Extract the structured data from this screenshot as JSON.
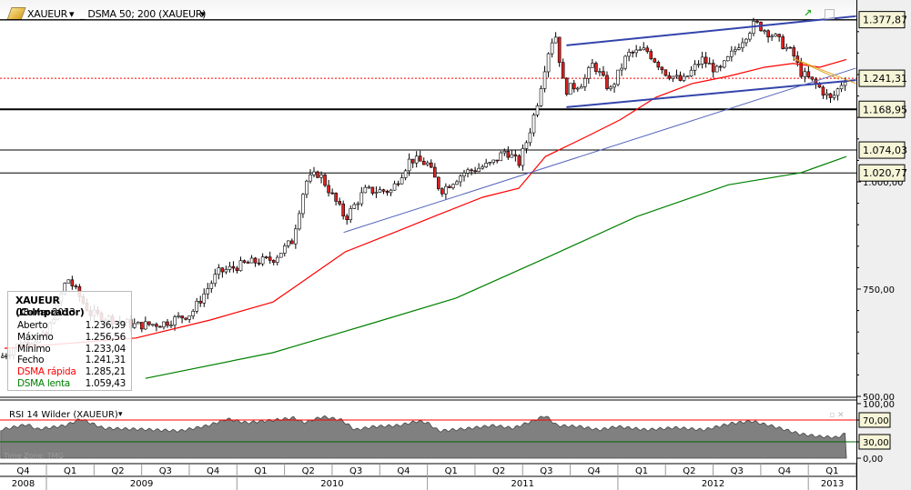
{
  "header": {
    "symbol": "XAUEUR",
    "indicator": "_ DSMA 50; 200 (XAUEUR)"
  },
  "info": {
    "title": "XAUEUR (Comprador)",
    "date": "18-Mar-2013",
    "rows": [
      {
        "label": "Aberto",
        "value": "1.236,39",
        "color": "#000000"
      },
      {
        "label": "Máximo",
        "value": "1.256,56",
        "color": "#000000"
      },
      {
        "label": "Mínimo",
        "value": "1.233,04",
        "color": "#000000"
      },
      {
        "label": "Fecho",
        "value": "1.241,31",
        "color": "#000000"
      },
      {
        "label": "DSMA rápida",
        "value": "1.285,21",
        "color": "#ff0000"
      },
      {
        "label": "DSMA lenta",
        "value": "1.059,43",
        "color": "#008000"
      }
    ]
  },
  "rsi": {
    "label": "RSI 14 Wilder (XAUEUR)",
    "time_zone": "Time Zone: TMG",
    "levels": [
      70,
      30
    ],
    "ticks": [
      "100,00",
      "70,00",
      "30,00",
      "0,00"
    ]
  },
  "chart_data": {
    "type": "candlestick",
    "title": "XAUEUR",
    "ylim": [
      500,
      1390
    ],
    "y_ticks": [
      "1.000,00",
      "750,00",
      "500,00"
    ],
    "price_labels": [
      "1.377,87",
      "1.241,31",
      "1.168,95",
      "1.074,03",
      "1.020,77"
    ],
    "horizontal_lines": [
      1377.87,
      1168.95,
      1074.03,
      1020.77
    ],
    "last_price": 1241.31,
    "x_quarters": [
      "Q4",
      "Q1",
      "Q2",
      "Q3",
      "Q4",
      "Q1",
      "Q2",
      "Q3",
      "Q4",
      "Q1",
      "Q2",
      "Q3",
      "Q4",
      "Q1",
      "Q2",
      "Q3",
      "Q4",
      "Q1"
    ],
    "x_years": [
      "2008",
      "2009",
      "2010",
      "2011",
      "2012",
      "2013"
    ],
    "price_path": [
      [
        2008.78,
        597
      ],
      [
        2008.85,
        620
      ],
      [
        2009.0,
        640
      ],
      [
        2009.11,
        777
      ],
      [
        2009.23,
        693
      ],
      [
        2009.47,
        665
      ],
      [
        2009.61,
        670
      ],
      [
        2009.76,
        693
      ],
      [
        2009.9,
        788
      ],
      [
        2010.05,
        810
      ],
      [
        2010.19,
        820
      ],
      [
        2010.29,
        862
      ],
      [
        2010.36,
        1000
      ],
      [
        2010.43,
        1021
      ],
      [
        2010.57,
        915
      ],
      [
        2010.67,
        979
      ],
      [
        2010.81,
        979
      ],
      [
        2010.91,
        1053
      ],
      [
        2011.0,
        1042
      ],
      [
        2011.07,
        979
      ],
      [
        2011.19,
        1021
      ],
      [
        2011.34,
        1042
      ],
      [
        2011.41,
        1074
      ],
      [
        2011.48,
        1042
      ],
      [
        2011.53,
        1106
      ],
      [
        2011.58,
        1190
      ],
      [
        2011.63,
        1297
      ],
      [
        2011.67,
        1350
      ],
      [
        2011.72,
        1212
      ],
      [
        2011.82,
        1233
      ],
      [
        2011.87,
        1276
      ],
      [
        2011.96,
        1212
      ],
      [
        2012.05,
        1297
      ],
      [
        2012.15,
        1307
      ],
      [
        2012.25,
        1255
      ],
      [
        2012.34,
        1233
      ],
      [
        2012.44,
        1286
      ],
      [
        2012.53,
        1255
      ],
      [
        2012.63,
        1318
      ],
      [
        2012.72,
        1370
      ],
      [
        2012.82,
        1339
      ],
      [
        2012.92,
        1297
      ],
      [
        2012.96,
        1255
      ],
      [
        2013.05,
        1223
      ],
      [
        2013.12,
        1190
      ],
      [
        2013.19,
        1241
      ]
    ],
    "series": [
      {
        "name": "DSMA rápida",
        "color": "#ff0000",
        "points": [
          [
            2008.78,
            612
          ],
          [
            2009.47,
            636
          ],
          [
            2009.86,
            678
          ],
          [
            2010.19,
            720
          ],
          [
            2010.33,
            763
          ],
          [
            2010.43,
            794
          ],
          [
            2010.57,
            837
          ],
          [
            2010.81,
            879
          ],
          [
            2011.05,
            922
          ],
          [
            2011.29,
            964
          ],
          [
            2011.48,
            985
          ],
          [
            2011.62,
            1059
          ],
          [
            2011.82,
            1102
          ],
          [
            2012.01,
            1144
          ],
          [
            2012.2,
            1197
          ],
          [
            2012.39,
            1229
          ],
          [
            2012.58,
            1246
          ],
          [
            2012.77,
            1267
          ],
          [
            2012.92,
            1276
          ],
          [
            2013.06,
            1267
          ],
          [
            2013.2,
            1285
          ]
        ]
      },
      {
        "name": "DSMA lenta",
        "color": "#008000",
        "points": [
          [
            2009.52,
            542
          ],
          [
            2010.19,
            602
          ],
          [
            2010.67,
            665
          ],
          [
            2011.15,
            729
          ],
          [
            2011.63,
            824
          ],
          [
            2012.1,
            919
          ],
          [
            2012.58,
            993
          ],
          [
            2012.96,
            1021
          ],
          [
            2013.2,
            1059
          ]
        ]
      }
    ],
    "trend_lines": [
      {
        "color": "#3344aa",
        "from": [
          2011.73,
          1318
        ],
        "to": [
          2013.25,
          1386
        ]
      },
      {
        "color": "#3344aa",
        "from": [
          2011.73,
          1174
        ],
        "to": [
          2013.25,
          1237
        ]
      },
      {
        "color": "#5566bb",
        "from": [
          2010.56,
          882
        ],
        "to": [
          2013.25,
          1265
        ]
      },
      {
        "color": "#e0a020",
        "from": [
          2012.92,
          1288
        ],
        "to": [
          2013.25,
          1229
        ]
      },
      {
        "color": "#e0a020",
        "from": [
          2012.92,
          1288
        ],
        "to": [
          2013.16,
          1239
        ]
      }
    ],
    "rsi_path": [
      [
        2008.76,
        52
      ],
      [
        2008.9,
        62
      ],
      [
        2008.95,
        53
      ],
      [
        2009.1,
        60
      ],
      [
        2009.18,
        72
      ],
      [
        2009.3,
        55
      ],
      [
        2009.5,
        53
      ],
      [
        2009.7,
        50
      ],
      [
        2009.85,
        60
      ],
      [
        2009.95,
        72
      ],
      [
        2010.05,
        65
      ],
      [
        2010.2,
        70
      ],
      [
        2010.3,
        74
      ],
      [
        2010.35,
        65
      ],
      [
        2010.45,
        76
      ],
      [
        2010.55,
        70
      ],
      [
        2010.62,
        52
      ],
      [
        2010.72,
        58
      ],
      [
        2010.85,
        60
      ],
      [
        2010.95,
        68
      ],
      [
        2011.0,
        65
      ],
      [
        2011.06,
        50
      ],
      [
        2011.2,
        54
      ],
      [
        2011.35,
        60
      ],
      [
        2011.45,
        55
      ],
      [
        2011.55,
        68
      ],
      [
        2011.62,
        78
      ],
      [
        2011.68,
        60
      ],
      [
        2011.8,
        58
      ],
      [
        2011.9,
        52
      ],
      [
        2012.0,
        58
      ],
      [
        2012.15,
        52
      ],
      [
        2012.3,
        56
      ],
      [
        2012.45,
        52
      ],
      [
        2012.6,
        64
      ],
      [
        2012.7,
        68
      ],
      [
        2012.82,
        58
      ],
      [
        2012.95,
        45
      ],
      [
        2013.05,
        40
      ],
      [
        2013.15,
        38
      ],
      [
        2013.2,
        46
      ]
    ]
  }
}
